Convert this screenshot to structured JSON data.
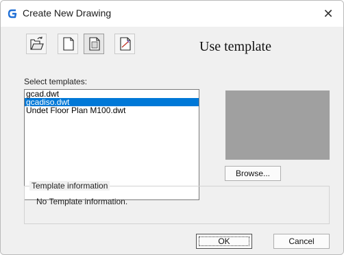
{
  "window": {
    "title": "Create New Drawing"
  },
  "toolbar": {
    "buttons": [
      {
        "icon": "open-folder-icon"
      },
      {
        "icon": "blank-drawing-icon"
      },
      {
        "icon": "template-icon",
        "active": true
      },
      {
        "icon": "wizard-icon"
      }
    ]
  },
  "mode_title": "Use template",
  "templates": {
    "label": "Select templates:",
    "items": [
      {
        "name": "gcad.dwt",
        "selected": false
      },
      {
        "name": "gcadiso.dwt",
        "selected": true
      },
      {
        "name": "Undet Floor Plan M100.dwt",
        "selected": false
      }
    ]
  },
  "preview": {
    "browse_label": "Browse..."
  },
  "template_info": {
    "title": "Template information",
    "text": "No Template information."
  },
  "buttons": {
    "ok": "OK",
    "cancel": "Cancel"
  },
  "colors": {
    "selection": "#0078d7",
    "preview": "#a0a0a0",
    "app_icon": "#1f6fd6"
  }
}
